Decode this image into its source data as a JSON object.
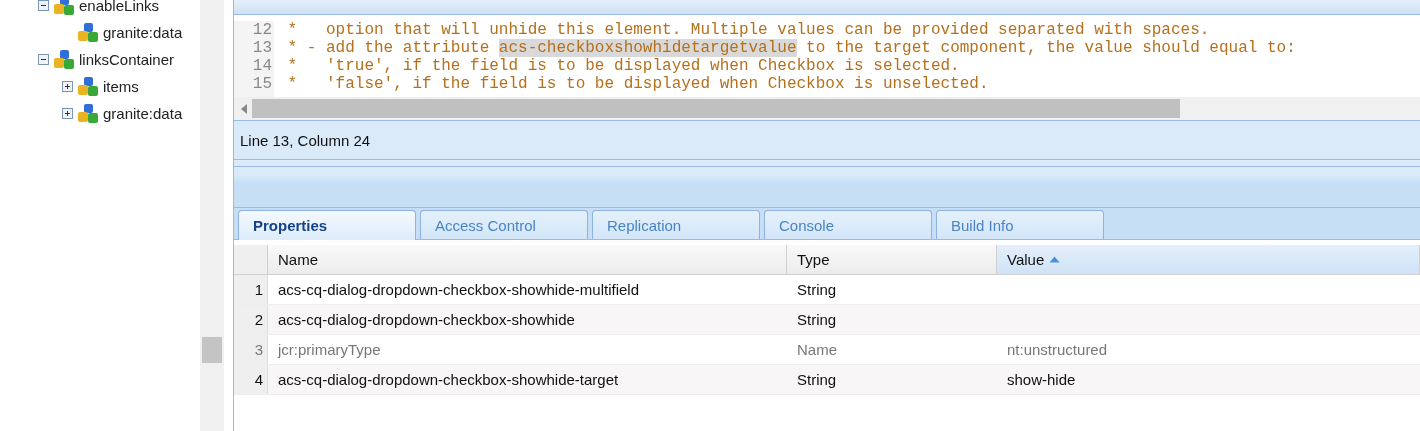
{
  "tree": [
    {
      "label": "enableLinks",
      "expanded": true,
      "children": [
        {
          "label": "granite:data"
        }
      ]
    },
    {
      "label": "linksContainer",
      "expanded": true,
      "children": [
        {
          "label": "items",
          "expanded": false
        },
        {
          "label": "granite:data",
          "expanded": false
        }
      ]
    }
  ],
  "editor": {
    "lines": [
      {
        "number": "12",
        "segments": [
          {
            "text": " *   option that will unhide this element. Multiple values can be provided separated with spaces.",
            "selected": false
          }
        ]
      },
      {
        "number": "13",
        "segments": [
          {
            "text": " * - add the attribute ",
            "selected": false
          },
          {
            "text": "acs-checkboxshowhidetargetvalue",
            "selected": true
          },
          {
            "text": " to the target component, the value should equal to:",
            "selected": false
          }
        ]
      },
      {
        "number": "14",
        "segments": [
          {
            "text": " *   'true', if the field is to be displayed when Checkbox is selected.",
            "selected": false
          }
        ]
      },
      {
        "number": "15",
        "segments": [
          {
            "text": " *   'false', if the field is to be displayed when Checkbox is unselected.",
            "selected": false
          }
        ]
      }
    ],
    "status": "Line 13, Column 24"
  },
  "tabs": [
    {
      "label": "Properties",
      "selected": true
    },
    {
      "label": "Access Control",
      "selected": false
    },
    {
      "label": "Replication",
      "selected": false
    },
    {
      "label": "Console",
      "selected": false
    },
    {
      "label": "Build Info",
      "selected": false
    }
  ],
  "table": {
    "columns": [
      {
        "label": "Name",
        "sorted": false
      },
      {
        "label": "Type",
        "sorted": false
      },
      {
        "label": "Value",
        "sorted": true
      }
    ],
    "rows": [
      {
        "number": "1",
        "name": "acs-cq-dialog-dropdown-checkbox-showhide-multifield",
        "type": "String",
        "disabled": false
      },
      {
        "number": "2",
        "name": "acs-cq-dialog-dropdown-checkbox-showhide",
        "type": "String",
        "disabled": false
      },
      {
        "number": "3",
        "name": "jcr:primaryType",
        "type": "Name",
        "value": "nt:unstructured",
        "disabled": true
      },
      {
        "number": "4",
        "name": "acs-cq-dialog-dropdown-checkbox-showhide-target",
        "type": "String",
        "value": "show-hide",
        "disabled": false
      }
    ]
  }
}
